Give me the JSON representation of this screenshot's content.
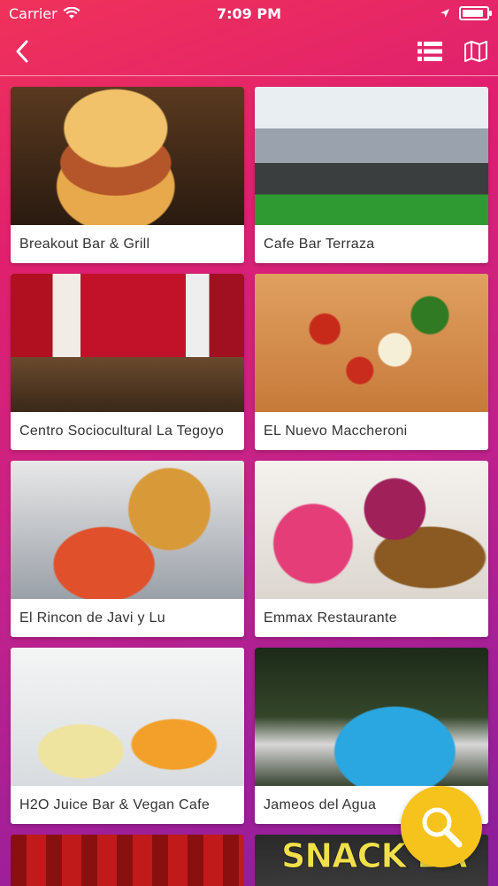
{
  "status_bar": {
    "carrier": "Carrier",
    "time": "7:09 PM"
  },
  "header": {
    "back_icon": "chevron-left-icon",
    "list_icon": "list-icon",
    "map_icon": "map-icon"
  },
  "restaurants": [
    {
      "name": "Breakout Bar & Grill"
    },
    {
      "name": "Cafe Bar Terraza"
    },
    {
      "name": "Centro Sociocultural La Tegoyo"
    },
    {
      "name": "EL Nuevo Maccheroni"
    },
    {
      "name": "El Rincon de Javi y Lu"
    },
    {
      "name": "Emmax Restaurante"
    },
    {
      "name": "H2O Juice Bar & Vegan Cafe"
    },
    {
      "name": "Jameos del Agua"
    }
  ],
  "partial_cards": {
    "snack_sign": "SNACK BA"
  },
  "fab": {
    "icon": "search-icon",
    "color": "#f6c21c"
  },
  "colors": {
    "gradient_top": "#f0325a",
    "gradient_bottom": "#8a1e9c",
    "card_bg": "#ffffff"
  }
}
